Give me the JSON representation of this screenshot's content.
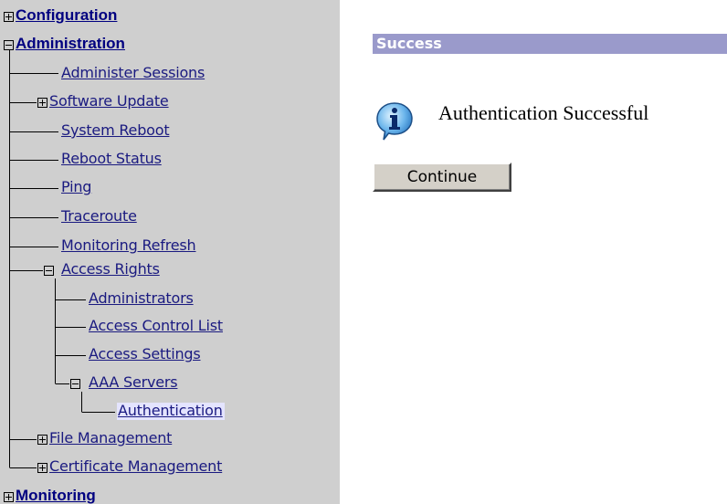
{
  "tree": {
    "configuration": "Configuration",
    "administration": "Administration",
    "administer_sessions": "Administer Sessions",
    "software_update": "Software Update",
    "system_reboot": "System Reboot",
    "reboot_status": "Reboot Status",
    "ping": "Ping",
    "traceroute": "Traceroute",
    "monitoring_refresh": "Monitoring Refresh",
    "access_rights": "Access Rights",
    "administrators": "Administrators",
    "access_control_list": "Access Control List",
    "access_settings": "Access Settings",
    "aaa_servers": "AAA Servers",
    "authentication": "Authentication",
    "file_management": "File Management",
    "certificate_management": "Certificate Management",
    "monitoring": "Monitoring"
  },
  "main": {
    "banner": "Success",
    "message": "Authentication Successful",
    "continue_label": "Continue",
    "icon": "info-icon"
  },
  "colors": {
    "sidebar_bg": "#cfcfcf",
    "banner_bg": "#9a9acb",
    "link": "#000080",
    "selected_bg": "#e4e4ff"
  }
}
